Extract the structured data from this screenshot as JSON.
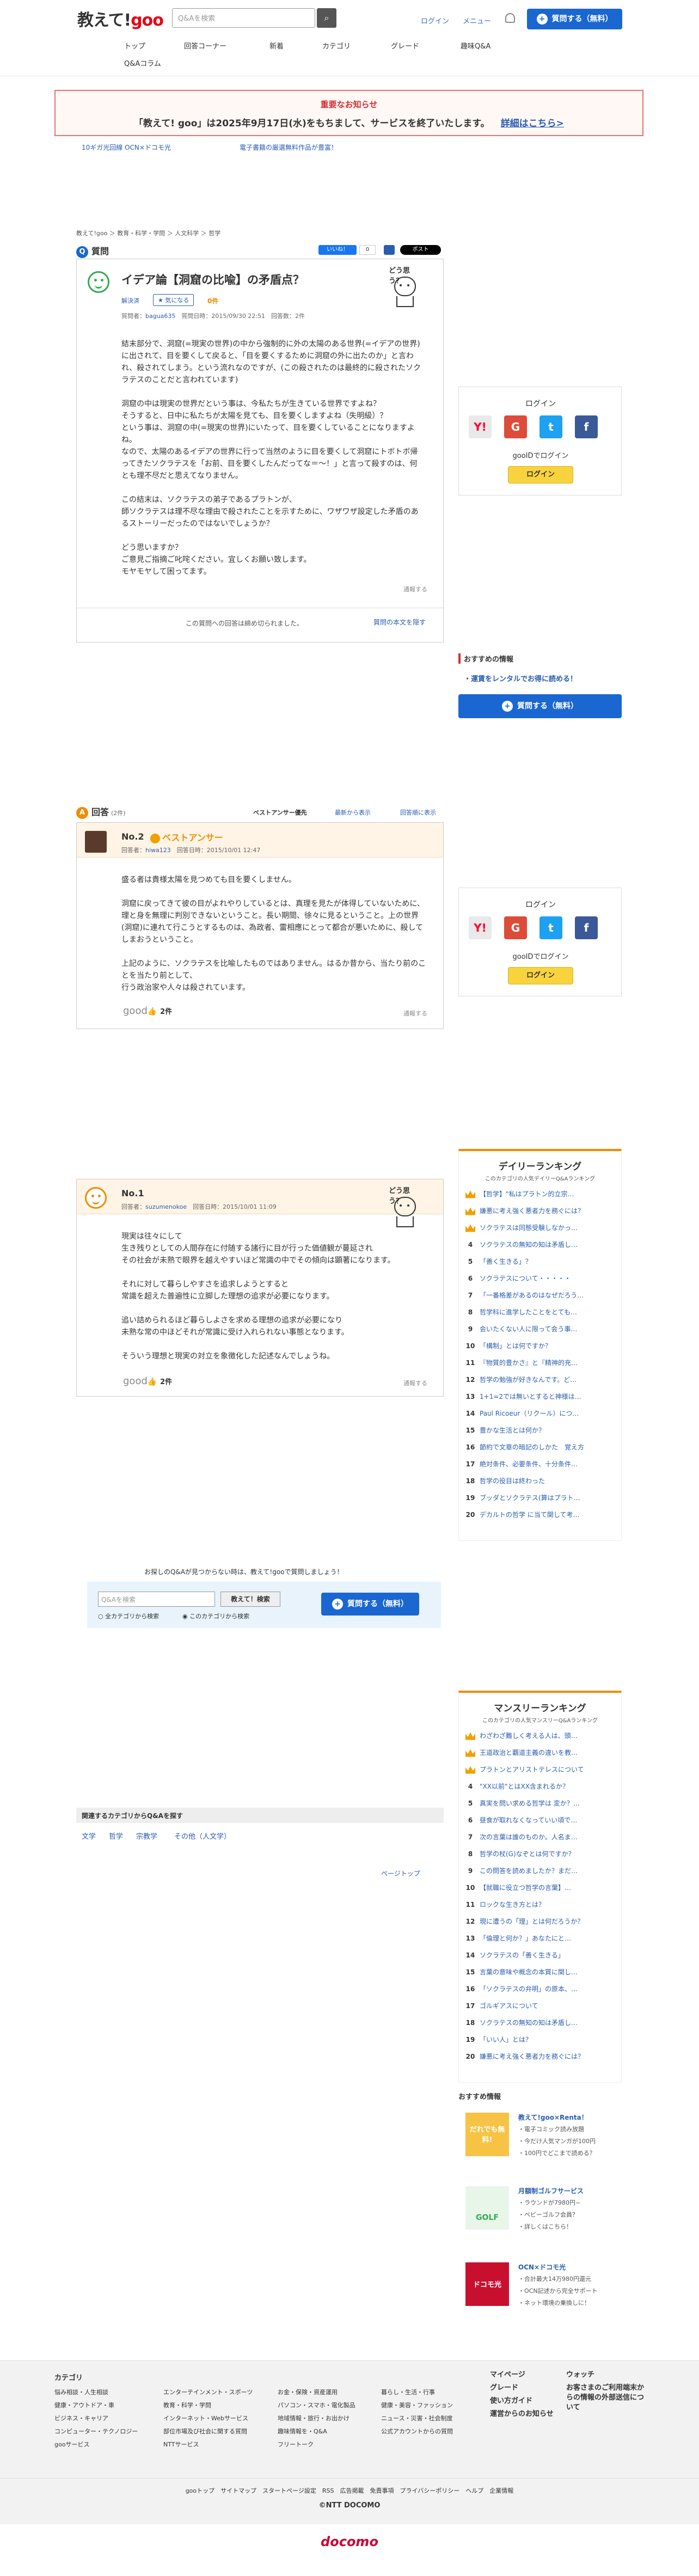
{
  "header": {
    "logo_main": "教えて!",
    "logo_goo": "goo",
    "search_placeholder": "Q&Aを検索",
    "login": "ログイン",
    "menu": "メニュー",
    "ask_button": "質問する（無料）",
    "nav": [
      "トップ",
      "回答コーナー",
      "新着",
      "カテゴリ",
      "グレード",
      "趣味Q&A",
      "Q&Aコラム"
    ]
  },
  "notice": {
    "title": "重要なお知らせ",
    "text": "「教えて! goo」は2025年9月17日(水)をもちまして、サービスを終了いたします。",
    "link": "詳細はこちら>"
  },
  "ads": [
    "10ギガ光回線 OCN×ドコモ光",
    "電子書籍の厳選無料作品が豊富！"
  ],
  "breadcrumb": "教えて!goo ＞ 教育・科学・学問 ＞ 人文科学 ＞ 哲学",
  "question": {
    "section_label": "質問",
    "title": "イデア論【洞窟の比喩】の矛盾点？",
    "badge": "解決済",
    "fav": "気になる",
    "fav_count": "0件",
    "asker_label": "質問者：",
    "asker": "bagua635",
    "date": "質問日時：2015/09/30 22:51",
    "answers": "回答数：2件",
    "doodle": "どう思う？",
    "body": "結末部分で、洞窟(=現実の世界)の中から強制的に外の太陽のある世界(=イデアの世界)に出されて、目を要くして戻ると、「目を要くするために洞窟の外に出たのか」と言われ、殺されてしまう。という流れなのですが、(この殺されたのは最終的に殺されたソクラテスのことだと言われています)\n\n洞窟の中は現実の世界だという事は、今私たちが生きている世界ですよね？\nそうすると、日中に私たちが太陽を見ても、目を要くしますよね（失明級）？\nという事は、洞窟の中(=現実の世界)にいたって、目を要くしていることになりますよね。\nなので、太陽のあるイデアの世界に行って当然のように目を要くして洞窟にトボトボ帰ってきたソクラテスを「お前、目を要くしたんだってな＝～！」と言って殺すのは、何とも理不尽だと思えてなりません。\n\nこの結末は、ソクラテスの弟子であるプラトンが、\n師ソクラテスは理不尽な理由で殺されたことを示すために、ワザワザ設定した矛盾のあるストーリーだったのではないでしょうか？\n\nどう思いますか？\nご意見ご指摘ご叱咤ください。宜しくお願い致します。\nモヤモヤして困ってます。",
    "report": "通報する",
    "closed": "この質問への回答は締め切られました。",
    "show_body": "質問の本文を隠す",
    "share_like": "いいね！",
    "share_count": "0",
    "share_post": "ポスト"
  },
  "answers_head": {
    "label": "回答",
    "count": "(2件)",
    "tabs": [
      "ベストアンサー優先",
      "最新から表示",
      "回答順に表示"
    ]
  },
  "answers": [
    {
      "no": "No.2",
      "best": "ベストアンサー",
      "respondent": "回答者：",
      "name": "hiwa123",
      "date": "回答日時：2015/10/01 12:47",
      "body": "盛る者は貴様太陽を見つめても目を要くしません。\n\n洞窟に戻ってきて彼の目がよれやりしているとは、真理を見たが体得していないために、理と身を無理に判別できないということ。長い期間、徐々に見るということ。上の世界(洞窟)に連れて行こうとするものは、為政者、雷相應にとって都合が悪いために、殺してしまおうということ。\n\n上記のように、ソクラテスを比喩したものではありません。はるか昔から、当たり前のことを当たり前として、\n行う政治家や人々は殺されています。",
      "good": "good",
      "good_count": "2件",
      "report": "通報する"
    },
    {
      "no": "No.1",
      "respondent": "回答者：",
      "name": "suzumenokoe",
      "date": "回答日時：2015/10/01 11:09",
      "body": "現実は往々にして\n生き残りとしての人間存在に付随する諸行に目が行った価値観が蔓延され\nその社会が未熟で眼界を越えやすいほど常識の中でその傾向は顕著になります。\n\nそれに対して暮らしやすさを追求しようとすると\n常識を超えた普遍性に立脚した理想の追求が必要になります。\n\n追い詰められるほど暮らしよさを求める理想の追求が必要になり\n未熟な常の中ほどそれが常識に受け入れられない事態となります。\n\nそういう理想と現実の対立を象徴化した記述なんでしょうね。",
      "good": "good",
      "good_count": "2件",
      "report": "通報する"
    }
  ],
  "sidebar_login": {
    "title": "ログイン",
    "sub": "gooIDでログイン",
    "button": "ログイン"
  },
  "recommend": {
    "title": "おすすめの情報",
    "link": "・運賃をレンタルでお得に読める！",
    "ask": "質問する（無料）"
  },
  "find": {
    "text": "お探しのQ&Aが見つからない時は、教えて!gooで質問しましょう！",
    "placeholder": "Q&Aを検索",
    "search_btn": "教えて！検索",
    "radio1": "全カテゴリから検索",
    "radio2": "このカテゴリから検索",
    "ask": "質問する（無料）"
  },
  "related": {
    "title": "関連するカテゴリからQ&Aを探す",
    "items": [
      "文学",
      "哲学",
      "宗教学",
      "その他（人文学）"
    ],
    "pagetop": "ページトップ"
  },
  "daily_ranking": {
    "title": "デイリーランキング",
    "sub": "このカテゴリの人気デイリーQ&Aランキング",
    "items": [
      "【哲学】\"私はプラトン的立宗…",
      "嫌悪に考え強く悪者力を務ぐには？",
      "ソクラテスは同態受験しなかっ…",
      "ソクラテスの無知の知は矛盾し…",
      "「善く生きる」？",
      "ソクラテスについて・・・・・",
      "「一番格差があるのはなぜだろう…",
      "哲学科に進学したことをとても…",
      "会いたくない人に限って会う事…",
      "「構制」とは何ですか？",
      "『物質的豊かさ』と『精神的充…",
      "哲学の勉強が好きなんです。ど…",
      "1+1=2では無いとすると神様は…",
      "Paul Ricoeur（リクール）につ…",
      "豊かな生活とは何か？",
      "節約で文章の暗記のしかた　覚え方",
      "絶対条件、必要条件、十分条件…",
      "哲学の役目は終わった",
      "ブッダとソクラテス(算はプラト…",
      "デカルトの哲学 に当て関して考…"
    ]
  },
  "monthly_ranking": {
    "title": "マンスリーランキング",
    "sub": "このカテゴリの人気マンスリーQ&Aランキング",
    "items": [
      "わざわざ難しく考える人は、頭…",
      "王道政治と覇道主義の違いを教…",
      "プラトンとアリストテレスについて",
      "\"XX以前\"とはXX含まれるか？",
      "真実を問い求める哲学は 変か？…",
      "昼食が取れなくなっていい頃で…",
      "次の言葉は誰のものか。人名ま…",
      "哲学の杖(G)なぞとは何ですか？",
      "この問答を読めましたか？まだ…",
      "【就職に役立つ哲学の言葉】…",
      "ロックな生き方とは？",
      "現に遭うの「理」とは何だろうか？",
      "「倫理と何か？」あなたにと…",
      "ソクラテスの「善く生きる」",
      "言葉の意味や概念の本質に関し…",
      "「ソクラテスの弁明」の原本、…",
      "ゴルギアスについて",
      "ソクラテスの無知の知は矛盾し…",
      "「いい人」とは？",
      "嫌悪に考え強く悪者力を務ぐには？"
    ]
  },
  "promo": {
    "title": "おすすめ情報",
    "items": [
      {
        "title": "教えて!goo×Renta！",
        "lines": [
          "・電子コミック読み放題",
          "・今だけ人気マンガが100円",
          "・100円でどこまで読める？"
        ],
        "img": "だれでも無料!"
      },
      {
        "title": "月額制ゴルフサービス",
        "lines": [
          "・ラウンドが7980円~",
          "・ベビーゴルフ会員？",
          "・詳しくはこちら！"
        ],
        "img": "GOLF"
      },
      {
        "title": "OCN×ドコモ光",
        "lines": [
          "・合計最大14万980円還元",
          "・OCN記述から完全サポート",
          "・ネット環境の乗換しに！"
        ],
        "img": "ドコモ光"
      }
    ]
  },
  "footer": {
    "category_title": "カテゴリ",
    "cols": [
      [
        "悩み相談・人生相談",
        "健康・アウトドア・車",
        "ビジネス・キャリア",
        "コンピューター・テクノロジー",
        "gooサービス"
      ],
      [
        "エンターテインメント・スポーツ",
        "教育・科学・学問",
        "インターネット・Webサービス",
        "部位市場及び社会に関する質問",
        "NTTサービス"
      ],
      [
        "お金・保険・資産運用",
        "パソコン・スマホ・電化製品",
        "地域情報・旅行・お出かけ",
        "趣味情報を・Q&A",
        "フリートーク"
      ],
      [
        "暮らし・生活・行事",
        "健康・美容・ファッション",
        "ニュース・災害・社会制度",
        "公式アカウントからの質問"
      ]
    ],
    "col5": [
      "マイページ",
      "グレード",
      "使い方ガイド",
      "運営からのお知らせ"
    ],
    "col6": [
      "ウォッチ",
      "お客さまのご利用端末からの情報の外部送信について"
    ],
    "links": "gooトップ　サイトマップ　スタートページ設定　RSS　広告掲載　免責事項　プライバシーポリシー　ヘルプ　企業情報",
    "copyright": "©NTT DOCOMO",
    "docomo": "docomo"
  }
}
